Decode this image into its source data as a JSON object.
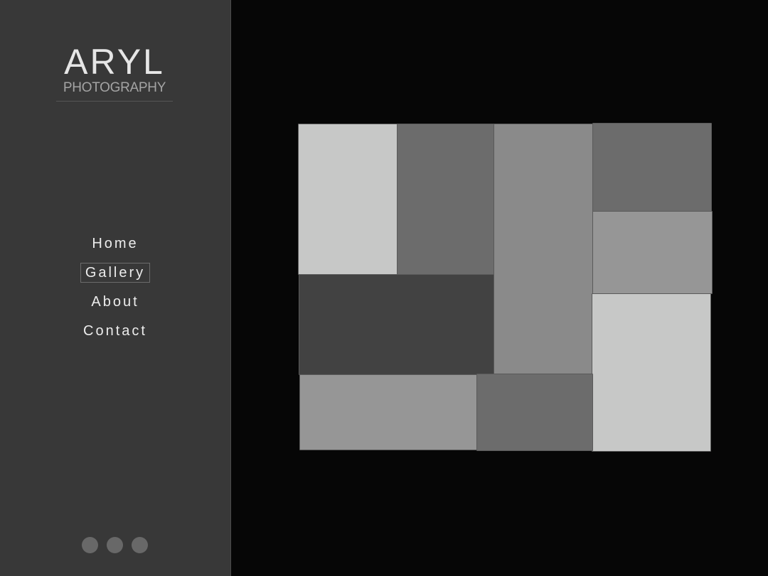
{
  "brand": {
    "name": "ARYL",
    "tagline": "PHOTOGRAPHY"
  },
  "nav": {
    "items": [
      {
        "label": "Home",
        "active": false
      },
      {
        "label": "Gallery",
        "active": true
      },
      {
        "label": "About",
        "active": false
      },
      {
        "label": "Contact",
        "active": false
      }
    ]
  },
  "social": {
    "icons": [
      "social-icon-1",
      "social-icon-2",
      "social-icon-3"
    ]
  },
  "colors": {
    "sidebar_bg": "#383838",
    "page_bg": "#060606",
    "active_border": "#6c6c6c",
    "tile_light": "#c7c8c7",
    "tile_mid": "#8a8a8a",
    "tile_dark": "#6c6c6c",
    "tile_darkest": "#424242",
    "tile_midlight": "#969696"
  },
  "gallery": {
    "thumbnails": [
      "photo-1",
      "photo-2",
      "photo-3",
      "photo-4",
      "photo-5",
      "photo-6",
      "photo-7",
      "photo-8",
      "photo-9",
      "photo-10"
    ]
  }
}
